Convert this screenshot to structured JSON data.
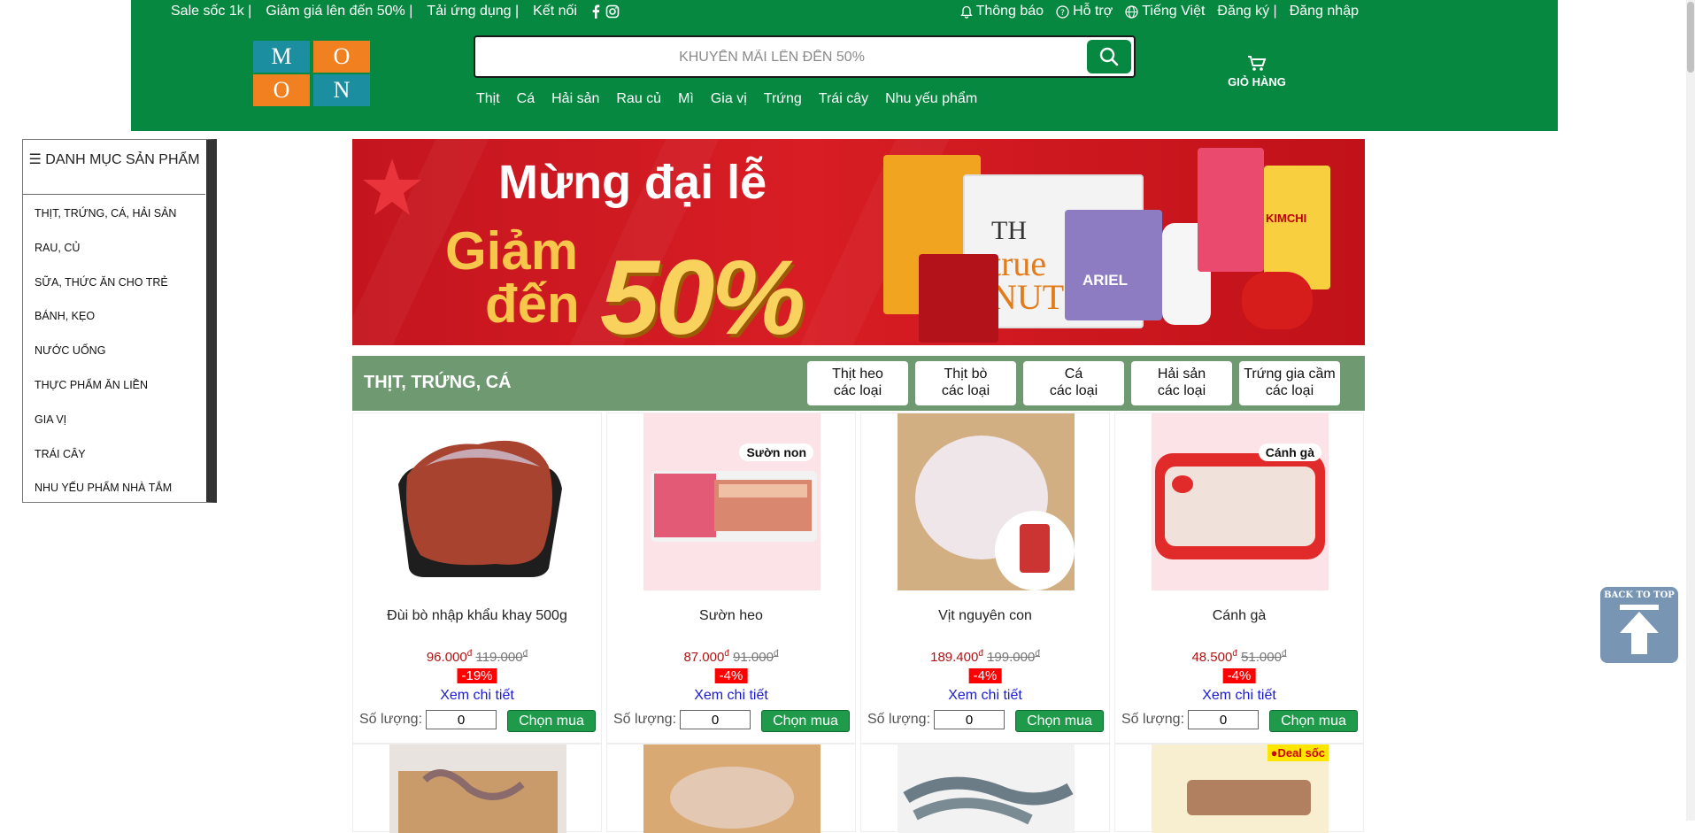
{
  "topbar": {
    "left_links": [
      "Sale sốc 1k |",
      "Giảm giá lên đến 50% |",
      "Tải ứng dụng |",
      "Kết nối"
    ],
    "notifications": "Thông báo",
    "support": "Hỗ trợ",
    "language": "Tiếng Việt",
    "register": "Đăng ký |",
    "login": "Đăng nhập"
  },
  "logo": {
    "letters": [
      "M",
      "O",
      "O",
      "N"
    ],
    "colors": [
      "#f08020",
      "#1b8fa0"
    ]
  },
  "search": {
    "placeholder": "KHUYẾN MÃI LÊN ĐẾN 50%",
    "value": ""
  },
  "nav": {
    "items": [
      "Thịt",
      "Cá",
      "Hải sản",
      "Rau củ",
      "Mì",
      "Gia vị",
      "Trứng",
      "Trái cây",
      "Nhu yếu phẩm"
    ]
  },
  "cart": {
    "label": "GIỎ HÀNG"
  },
  "sidebar": {
    "title": "DANH MỤC SẢN PHẨM",
    "items": [
      "THỊT, TRỨNG, CÁ, HẢI SẢN",
      "RAU, CỦ",
      "SỮA, THỨC ĂN CHO TRẺ",
      "BÁNH, KẸO",
      "NƯỚC UỐNG",
      "THỰC PHẨM ĂN LIỀN",
      "GIA VỊ",
      "TRÁI CÂY",
      "NHU YẾU PHẨM NHÀ TẮM"
    ]
  },
  "banner": {
    "title": "Mừng đại lễ",
    "line1": "Giảm",
    "line2": "đến",
    "percent": "50%",
    "brand_true": "TH",
    "brand_nut": "true NUT",
    "brand_ariel": "ARIEL",
    "brand_kimchi": "KIMCHI"
  },
  "section": {
    "title": "THỊT, TRỨNG, CÁ",
    "subcats": [
      [
        "Thịt heo",
        "các loại"
      ],
      [
        "Thịt bò",
        "các loại"
      ],
      [
        "Cá",
        "các loại"
      ],
      [
        "Hải sản",
        "các loại"
      ],
      [
        "Trứng gia cầm",
        "các loại"
      ]
    ]
  },
  "products": [
    {
      "name": "Đùi bò nhập khẩu khay 500g",
      "price": "96.000",
      "old_price": "119.000",
      "discount": "-19%",
      "detail": "Xem chi tiết",
      "qty_label": "Số lượng:",
      "qty": "0",
      "buy": "Chọn mua",
      "tag": ""
    },
    {
      "name": "Sườn heo",
      "price": "87.000",
      "old_price": "91.000",
      "discount": "-4%",
      "detail": "Xem chi tiết",
      "qty_label": "Số lượng:",
      "qty": "0",
      "buy": "Chọn mua",
      "tag": "Sườn non"
    },
    {
      "name": "Vịt nguyên con",
      "price": "189.400",
      "old_price": "199.000",
      "discount": "-4%",
      "detail": "Xem chi tiết",
      "qty_label": "Số lượng:",
      "qty": "0",
      "buy": "Chọn mua",
      "tag": ""
    },
    {
      "name": "Cánh gà",
      "price": "48.500",
      "old_price": "51.000",
      "discount": "-4%",
      "detail": "Xem chi tiết",
      "qty_label": "Số lượng:",
      "qty": "0",
      "buy": "Chọn mua",
      "tag": "Cánh gà"
    }
  ],
  "currency": "đ",
  "deal_badge": "Deal sốc",
  "back_to_top": "BACK TO TOP"
}
